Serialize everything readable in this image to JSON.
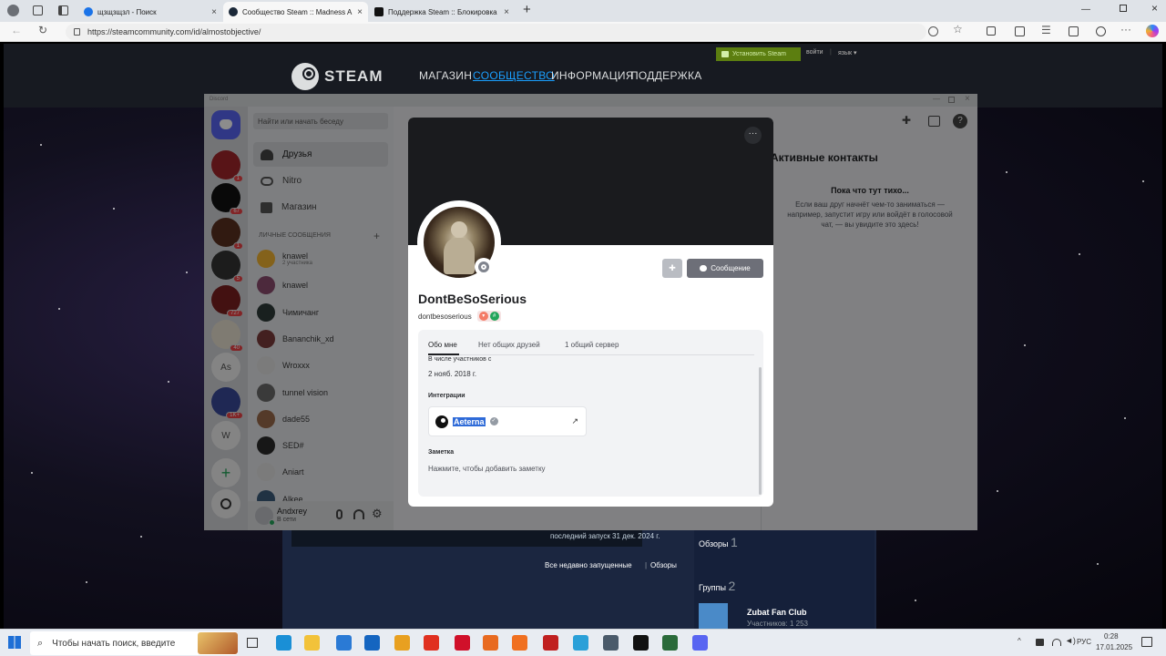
{
  "browser": {
    "tabs": [
      {
        "title": "щзщзщзл - Поиск",
        "icon_color": "#1a73e8"
      },
      {
        "title": "Сообщество Steam :: Madness A",
        "icon_color": "#1b2838"
      },
      {
        "title": "Поддержка Steam :: Блокировка",
        "icon_color": "#111111"
      }
    ],
    "new_tab": "+",
    "url": "https://steamcommunity.com/id/almostobjective/"
  },
  "steam": {
    "logo": "STEAM",
    "nav": [
      "МАГАЗИН",
      "СООБЩЕСТВО",
      "ИНФОРМАЦИЯ",
      "ПОДДЕРЖКА"
    ],
    "install_label": "Установить Steam",
    "login_label": "войти",
    "lang_label": "язык",
    "last_launch": "последний запуск 31 дек. 2024 г.",
    "recent_link": "Все недавно запущенные",
    "reviews_link": "Обзоры",
    "reviews_label": "Обзоры",
    "reviews_count": "1",
    "groups_label": "Группы",
    "groups_count": "2",
    "group_name": "Zubat Fan Club",
    "group_members": "Участников: 1 253"
  },
  "discord": {
    "title": "Discord",
    "search_placeholder": "Найти или начать беседу",
    "nav": {
      "friends": "Друзья",
      "nitro": "Nitro",
      "shop": "Магазин"
    },
    "dm_header": "ЛИЧНЫЕ СООБЩЕНИЯ",
    "dm_add": "+",
    "dms": [
      {
        "name": "knawel",
        "sub": "2 участника",
        "color": "#f0b232"
      },
      {
        "name": "knawel",
        "sub": "",
        "color": "#8a4b6e"
      },
      {
        "name": "Чимичанг",
        "sub": "",
        "color": "#2e3b3a"
      },
      {
        "name": "Bananchik_xd",
        "sub": "",
        "color": "#7a3b3b"
      },
      {
        "name": "Wroxxx",
        "sub": "",
        "color": "#e0e0e0"
      },
      {
        "name": "tunnel vision",
        "sub": "",
        "color": "#6b6b6b"
      },
      {
        "name": "dade55",
        "sub": "",
        "color": "#9a6b4b"
      },
      {
        "name": "SED#",
        "sub": "",
        "color": "#2a2a2a"
      },
      {
        "name": "Aniart",
        "sub": "",
        "color": "#e0e0e0"
      },
      {
        "name": "Alkee",
        "sub": "",
        "color": "#3b5b7b"
      }
    ],
    "guilds": [
      {
        "label": "",
        "badge": "1",
        "color": "#a0262a"
      },
      {
        "label": "",
        "badge": "67",
        "color": "#111111"
      },
      {
        "label": "",
        "badge": "1",
        "color": "#5a3020"
      },
      {
        "label": "",
        "badge": "5",
        "color": "#333333"
      },
      {
        "label": "",
        "badge": "727",
        "color": "#7a2020"
      },
      {
        "label": "",
        "badge": "40",
        "color": "#e8e0d0"
      },
      {
        "label": "As",
        "badge": "",
        "color": "#f0f0f0"
      },
      {
        "label": "",
        "badge": "1K+",
        "color": "#3a4a9a"
      },
      {
        "label": "W",
        "badge": "",
        "color": "#f0f0f0"
      }
    ],
    "user": {
      "name": "Andxrey",
      "status": "В сети"
    },
    "active_now": {
      "title": "Активные контакты",
      "empty_title": "Пока что тут тихо...",
      "empty_text": "Если ваш друг начнёт чем-то заниматься — например, запустит игру или войдёт в голосовой чат, — вы увидите это здесь!"
    }
  },
  "profile": {
    "display_name": "DontBeSoSerious",
    "username": "dontbesoserious",
    "message_button": "Сообщение",
    "more": "···",
    "tabs": [
      "Обо мне",
      "Нет общих друзей",
      "1 общий сервер"
    ],
    "member_since_label": "В числе участников с",
    "member_since": "2 нояб. 2018 г.",
    "integrations_label": "Интеграции",
    "integration_name": "Aeterna",
    "note_label": "Заметка",
    "note_placeholder": "Нажмите, чтобы добавить заметку"
  },
  "taskbar": {
    "search_placeholder": "Чтобы начать поиск, введите",
    "lang": "РУС",
    "time": "0:28",
    "date": "17.01.2025",
    "icons": [
      {
        "name": "edge-icon",
        "color": "#1a8fd6"
      },
      {
        "name": "folder-icon",
        "color": "#f2c23a"
      },
      {
        "name": "store-icon",
        "color": "#2a7ad5"
      },
      {
        "name": "outlook-icon",
        "color": "#1565c0"
      },
      {
        "name": "chrome-icon",
        "color": "#e8a020"
      },
      {
        "name": "yandex-icon",
        "color": "#e03020"
      },
      {
        "name": "opera-icon",
        "color": "#d0102a"
      },
      {
        "name": "firefox-icon",
        "color": "#e86a20"
      },
      {
        "name": "firefox-dev-icon",
        "color": "#f07020"
      },
      {
        "name": "opera-gx-icon",
        "color": "#c02020"
      },
      {
        "name": "telegram-icon",
        "color": "#2aa0d8"
      },
      {
        "name": "steam-icon",
        "color": "#4a5a6a"
      },
      {
        "name": "capcut-icon",
        "color": "#111111"
      },
      {
        "name": "app-icon",
        "color": "#2a6a3a"
      },
      {
        "name": "discord-icon",
        "color": "#5865f2"
      }
    ]
  }
}
